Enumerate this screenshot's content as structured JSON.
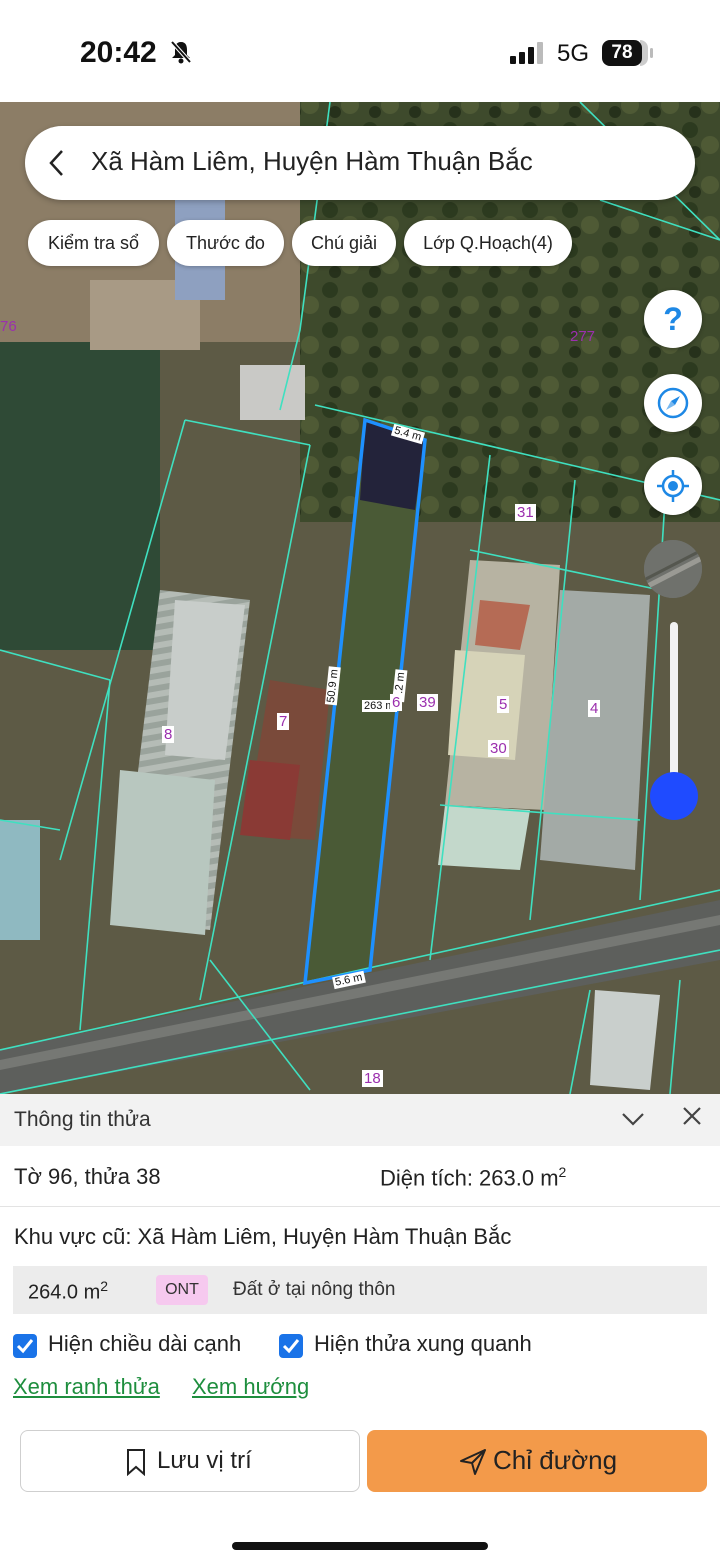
{
  "status_bar": {
    "time": "20:42",
    "network": "5G",
    "battery": "78"
  },
  "search": {
    "title": "Xã Hàm Liêm, Huyện Hàm Thuận Bắc"
  },
  "chips": [
    "Kiểm tra sổ",
    "Thước đo",
    "Chú giải",
    "Lớp Q.Hoạch(4)"
  ],
  "map": {
    "parcel_labels": [
      "76",
      "277",
      "31",
      "8",
      "7",
      "39",
      "5",
      "4",
      "30",
      "18"
    ],
    "edge_lengths": {
      "top": "5.4 m",
      "left": "50.9 m",
      "right": "6.2 m",
      "bottom": "5.6 m"
    },
    "area_label": "263 m",
    "parcel_number": "6",
    "parcel_outline_color": "#1e90ff",
    "boundary_color": "#3fe0c0",
    "label_color": "#9b2fae"
  },
  "panel": {
    "title": "Thông tin thửa",
    "sheet_parcel": "Tờ 96, thửa 38",
    "area_label": "Diện tích: 263.0 m",
    "area_sup": "2",
    "old_area": "Khu vực cũ: Xã Hàm Liêm, Huyện Hàm Thuận Bắc",
    "zone_area": "264.0 m",
    "zone_area_sup": "2",
    "zone_code": "ONT",
    "zone_desc": "Đất ở tại nông thôn",
    "check_edges": "Hiện chiều dài cạnh",
    "check_neighbors": "Hiện thửa xung quanh",
    "link_boundary": "Xem ranh thửa",
    "link_direction": "Xem hướng",
    "save_button": "Lưu vị trí",
    "directions_button": "Chỉ đường"
  }
}
